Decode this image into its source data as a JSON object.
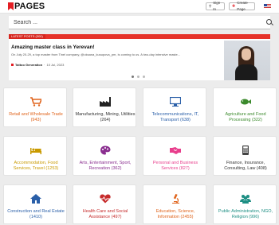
{
  "header": {
    "logo_text": "PAGES",
    "sign_in_label": "Sign In",
    "create_page_label": "Create Page",
    "language": "US"
  },
  "search": {
    "placeholder": "Search ..."
  },
  "news": {
    "section_label": "LATEST POSTS (300)",
    "title": "Amazing master class in Yerevan!",
    "text": "On July 20-29, a top master from Tinel company, @oksana_kusupova_pm, is coming to us. A two-day intensive maste...",
    "author": "Tattoo Generation",
    "date": "10 Jul, 2023",
    "carousel_pages": 3,
    "carousel_active": 1
  },
  "categories": [
    {
      "label": "Retail and Wholesale Trade (943)",
      "icon": "shopping-cart-icon",
      "color": "orange"
    },
    {
      "label": "Manufacturing, Mining, Utilities (264)",
      "icon": "factory-icon",
      "color": "dark"
    },
    {
      "label": "Telecommunications, IT, Transport (638)",
      "icon": "monitor-icon",
      "color": "blue"
    },
    {
      "label": "Agriculture and Food Processing (322)",
      "icon": "fish-icon",
      "color": "green"
    },
    {
      "label": "Accommodation, Food Services, Travel (1253)",
      "icon": "bed-icon",
      "color": "yellow"
    },
    {
      "label": "Arts, Entertainment, Sport, Recreation (362)",
      "icon": "palette-icon",
      "color": "purple"
    },
    {
      "label": "Personal and Business Services (827)",
      "icon": "handshake-icon",
      "color": "pink"
    },
    {
      "label": "Finance, Insurance, Consulting, Law (408)",
      "icon": "calculator-icon",
      "color": "dark"
    },
    {
      "label": "Construction and Real Estate (1410)",
      "icon": "home-icon",
      "color": "blue"
    },
    {
      "label": "Health Care and Social Assistance (497)",
      "icon": "heartbeat-icon",
      "color": "red"
    },
    {
      "label": "Education, Science, Information (2455)",
      "icon": "microscope-icon",
      "color": "orange"
    },
    {
      "label": "Public Administration, NGO, Religion (996)",
      "icon": "users-icon",
      "color": "teal"
    }
  ]
}
